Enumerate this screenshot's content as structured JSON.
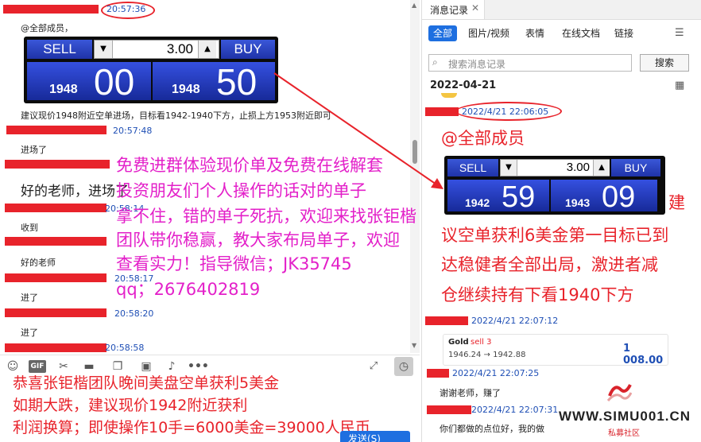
{
  "left": {
    "timestamps": [
      "20:57:36",
      "20:57:48",
      "20:58:14",
      "20:58:17",
      "20:58:20",
      "20:58:58"
    ],
    "mention": "@全部成员，",
    "trade": {
      "sell": "SELL",
      "buy": "BUY",
      "qty": "3.00",
      "sell_small": "1948",
      "sell_big": "00",
      "buy_small": "1948",
      "buy_big": "50"
    },
    "advice": "建议现价1948附近空单进场，目标看1942-1940下方，止损上方1953附近即可",
    "messages": [
      "进场了",
      "好的老师，进场了",
      "收到",
      "好的老师",
      "进了",
      "进了"
    ],
    "toolbar_icons": [
      "emoji-icon",
      "gif-icon",
      "scissors-icon",
      "folder-icon",
      "clip-icon",
      "image-icon",
      "bell-icon",
      "more-icon"
    ],
    "gif_label": "GIF",
    "send_label": "发送(S)"
  },
  "overlay": {
    "magenta": [
      "免费进群体验现价单及免费在线解套",
      "投资朋友们个人操作的话对的单子",
      "拿不住，错的单子死抗，欢迎来找张钜楷",
      "团队带你稳赢，教大家布局单子，欢迎",
      "查看实力！指导微信；JK35745",
      "qq；2676402819"
    ],
    "bottom_red": [
      "恭喜张钜楷团队晚间美盘空单获利5美金",
      "如期大跌，建议现价1942附近获利",
      "利润换算；即使操作10手=6000美金=39000人民币"
    ],
    "right_red": [
      "建",
      "议空单获利6美金第一目标已到",
      "达稳健者全部出局，激进者减",
      "仓继续持有下看1940下方"
    ]
  },
  "right": {
    "tab_title": "消息记录",
    "filters": [
      "全部",
      "图片/视频",
      "表情",
      "在线文档",
      "链接"
    ],
    "search_placeholder": "搜索消息记录",
    "search_button": "搜索",
    "date": "2022-04-21",
    "ts1": "2022/4/21 22:06:05",
    "mention": "@全部成员",
    "trade": {
      "sell": "SELL",
      "buy": "BUY",
      "qty": "3.00",
      "sell_small": "1942",
      "sell_big": "59",
      "buy_small": "1943",
      "buy_big": "09"
    },
    "ts2": "2022/4/21 22:07:12",
    "card": {
      "title": "Gold",
      "action": "sell 3",
      "route": "1946.24 → 1942.88",
      "profit": "1 008.00"
    },
    "ts3": "2022/4/21 22:07:25",
    "thanks": "谢谢老师，赚了",
    "ts4": "2022/4/21 22:07:31",
    "question": "你们都做的点位好，我的做"
  },
  "watermark": {
    "site": "WWW.SIMU001.CN",
    "sub": "私募社区"
  },
  "colors": {
    "accent": "#1e6fe0",
    "red": "#e8232b",
    "magenta": "#e320c9",
    "profit": "#1f4fb5"
  }
}
